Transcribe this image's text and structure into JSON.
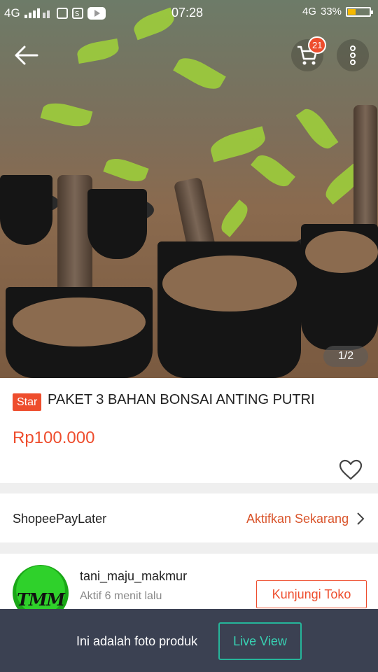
{
  "status_bar": {
    "network_left": "4G",
    "time": "07:28",
    "network_right": "4G",
    "battery": "33%",
    "battery_level": 0.33
  },
  "image_gallery": {
    "page_indicator": "1/2"
  },
  "header": {
    "cart_count": "21",
    "icons": [
      "back-arrow-icon",
      "cart-icon",
      "more-vertical-icon"
    ]
  },
  "product": {
    "badge": "Star",
    "title": "PAKET 3 BAHAN BONSAI ANTING PUTRI",
    "price": "Rp100.000"
  },
  "paylater": {
    "label": "ShopeePayLater",
    "action": "Aktifkan Sekarang"
  },
  "shop": {
    "name": "tani_maju_makmur",
    "active_status": "Aktif 6 menit lalu",
    "logo_text": "TMM",
    "visit_label": "Kunjungi Toko"
  },
  "bottom_bar": {
    "text": "Ini adalah foto produk",
    "live_view_label": "Live View"
  },
  "colors": {
    "accent": "#ee4d2d",
    "bottom_bar": "#3b4152",
    "live_view": "#26b59a"
  }
}
